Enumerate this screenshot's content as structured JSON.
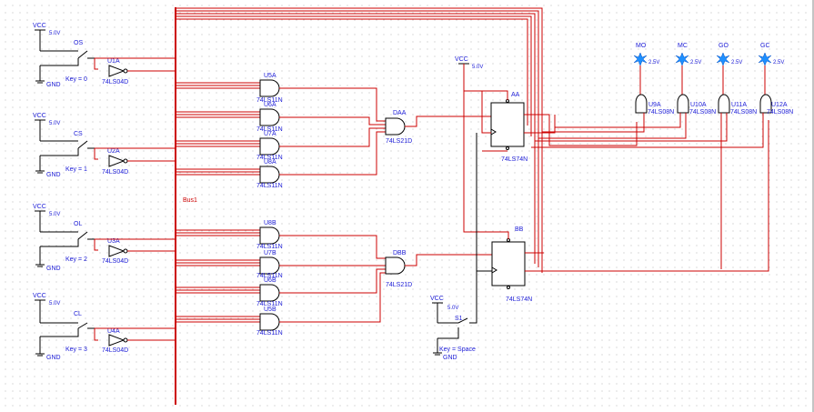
{
  "switches": [
    {
      "vcc": "VCC",
      "volt": "5.0V",
      "name": "OS",
      "key": "Key = 0",
      "gnd": "GND",
      "inv": "U1A",
      "part": "74LS04D"
    },
    {
      "vcc": "VCC",
      "volt": "5.0V",
      "name": "CS",
      "key": "Key = 1",
      "gnd": "GND",
      "inv": "U2A",
      "part": "74LS04D"
    },
    {
      "vcc": "VCC",
      "volt": "5.0V",
      "name": "OL",
      "key": "Key = 2",
      "gnd": "GND",
      "inv": "U3A",
      "part": "74LS04D"
    },
    {
      "vcc": "VCC",
      "volt": "5.0V",
      "name": "CL",
      "key": "Key = 3",
      "gnd": "GND",
      "inv": "U4A",
      "part": "74LS04D"
    }
  ],
  "bus_label": "Bus1",
  "and3_gates": [
    {
      "name": "U5A",
      "part": "74LS11N"
    },
    {
      "name": "U6A",
      "part": "74LS11N"
    },
    {
      "name": "U7A",
      "part": "74LS11N"
    },
    {
      "name": "U8A",
      "part": "74LS11N"
    },
    {
      "name": "U8B",
      "part": "74LS11N"
    },
    {
      "name": "U7B",
      "part": "74LS11N"
    },
    {
      "name": "U6B",
      "part": "74LS11N"
    },
    {
      "name": "U5B",
      "part": "74LS11N"
    }
  ],
  "and4_gates": [
    {
      "name": "DAA",
      "part": "74LS21D"
    },
    {
      "name": "DBB",
      "part": "74LS21D"
    }
  ],
  "flipflops": [
    {
      "name": "AA",
      "part": "74LS74N"
    },
    {
      "name": "BB",
      "part": "74LS74N"
    }
  ],
  "clock": {
    "vcc": "VCC",
    "volt": "5.0V",
    "name": "S1",
    "key": "Key = Space",
    "gnd": "GND"
  },
  "aux_vcc": {
    "label": "VCC",
    "volt": "5.0V"
  },
  "probes": [
    {
      "name": "MO",
      "volt": "2.5V"
    },
    {
      "name": "MC",
      "volt": "2.5V"
    },
    {
      "name": "GO",
      "volt": "2.5V"
    },
    {
      "name": "GC",
      "volt": "2.5V"
    }
  ],
  "and2_gates": [
    {
      "name": "U9A",
      "part": "74LS08N"
    },
    {
      "name": "U10A",
      "part": "74LS08N"
    },
    {
      "name": "U11A",
      "part": "74LS08N"
    },
    {
      "name": "U12A",
      "part": "74LS08N"
    }
  ],
  "colors": {
    "wire": "#cc0000",
    "label": "#1a1ad6",
    "probe": "#1e90ff"
  }
}
